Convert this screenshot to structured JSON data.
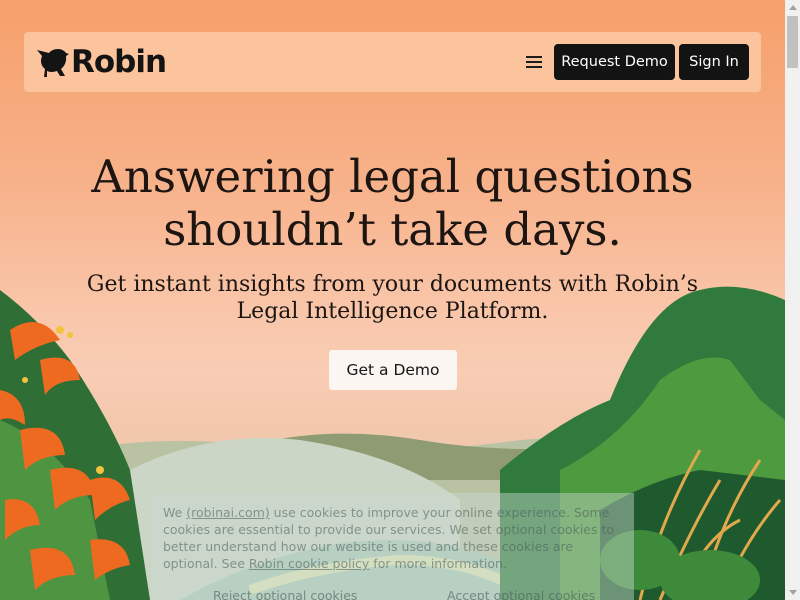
{
  "brand": {
    "name": "Robin",
    "logo_icon": "robin-bird-icon"
  },
  "nav": {
    "menu_icon": "hamburger-menu-icon",
    "request_demo_label": "Request Demo",
    "sign_in_label": "Sign In"
  },
  "hero": {
    "title_line1": "Answering legal questions",
    "title_line2": "shouldn’t take days.",
    "subtitle_line1": "Get instant insights from your documents with Robin’s",
    "subtitle_line2": "Legal Intelligence Platform.",
    "cta_label": "Get a Demo"
  },
  "cookie_banner": {
    "text_before_link": "We ",
    "site_link": "(robinai.com)",
    "text_after_link": " use cookies to improve your online experience. Some cookies are essential to provide our services. We set optional cookies to better understand how our website is used and these cookies are optional. See ",
    "policy_link": "Robin cookie policy",
    "text_end": " for more information.",
    "reject_label": "Reject optional cookies",
    "accept_label": "Accept optional cookies"
  },
  "colors": {
    "sky_top": "#f6a06b",
    "sky_bottom": "#f9c6aa",
    "nav_background": "#fbc49d",
    "button_dark": "#131313",
    "cta_background": "#fbf6f1"
  }
}
